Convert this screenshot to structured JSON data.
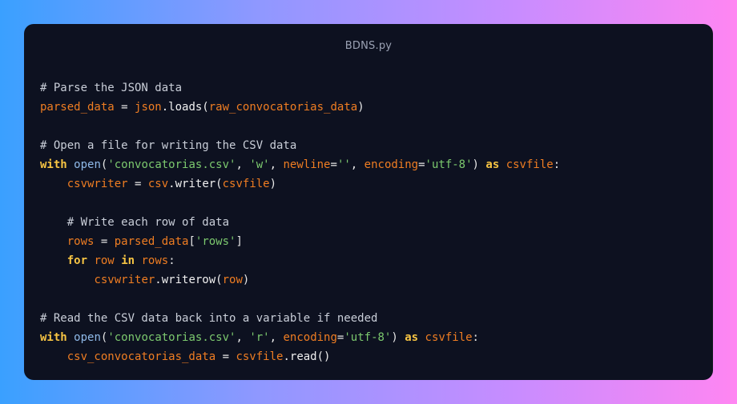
{
  "window": {
    "title": "BDNS.py"
  },
  "code_lines": [
    [
      {
        "t": "# Parse the JSON data",
        "k": "comment"
      }
    ],
    [
      {
        "t": "parsed_data",
        "k": "var"
      },
      {
        "t": " = ",
        "k": "plain"
      },
      {
        "t": "json",
        "k": "var"
      },
      {
        "t": ".loads(",
        "k": "fn"
      },
      {
        "t": "raw_convocatorias_data",
        "k": "var"
      },
      {
        "t": ")",
        "k": "plain"
      }
    ],
    [],
    [
      {
        "t": "# Open a file for writing the CSV data",
        "k": "comment"
      }
    ],
    [
      {
        "t": "with",
        "k": "kw"
      },
      {
        "t": " ",
        "k": "plain"
      },
      {
        "t": "open",
        "k": "builtin"
      },
      {
        "t": "(",
        "k": "plain"
      },
      {
        "t": "'convocatorias.csv'",
        "k": "str"
      },
      {
        "t": ", ",
        "k": "plain"
      },
      {
        "t": "'w'",
        "k": "str"
      },
      {
        "t": ", ",
        "k": "plain"
      },
      {
        "t": "newline",
        "k": "var"
      },
      {
        "t": "=",
        "k": "plain"
      },
      {
        "t": "''",
        "k": "str"
      },
      {
        "t": ", ",
        "k": "plain"
      },
      {
        "t": "encoding",
        "k": "var"
      },
      {
        "t": "=",
        "k": "plain"
      },
      {
        "t": "'utf-8'",
        "k": "str"
      },
      {
        "t": ") ",
        "k": "plain"
      },
      {
        "t": "as",
        "k": "kw"
      },
      {
        "t": " ",
        "k": "plain"
      },
      {
        "t": "csvfile",
        "k": "var"
      },
      {
        "t": ":",
        "k": "plain"
      }
    ],
    [
      {
        "t": "    ",
        "k": "plain"
      },
      {
        "t": "csvwriter",
        "k": "var"
      },
      {
        "t": " = ",
        "k": "plain"
      },
      {
        "t": "csv",
        "k": "var"
      },
      {
        "t": ".writer(",
        "k": "fn"
      },
      {
        "t": "csvfile",
        "k": "var"
      },
      {
        "t": ")",
        "k": "plain"
      }
    ],
    [],
    [
      {
        "t": "    # Write each row of data",
        "k": "comment"
      }
    ],
    [
      {
        "t": "    ",
        "k": "plain"
      },
      {
        "t": "rows",
        "k": "var"
      },
      {
        "t": " = ",
        "k": "plain"
      },
      {
        "t": "parsed_data",
        "k": "var"
      },
      {
        "t": "[",
        "k": "plain"
      },
      {
        "t": "'rows'",
        "k": "str"
      },
      {
        "t": "]",
        "k": "plain"
      }
    ],
    [
      {
        "t": "    ",
        "k": "plain"
      },
      {
        "t": "for",
        "k": "kw"
      },
      {
        "t": " ",
        "k": "plain"
      },
      {
        "t": "row",
        "k": "var"
      },
      {
        "t": " ",
        "k": "plain"
      },
      {
        "t": "in",
        "k": "kw"
      },
      {
        "t": " ",
        "k": "plain"
      },
      {
        "t": "rows",
        "k": "var"
      },
      {
        "t": ":",
        "k": "plain"
      }
    ],
    [
      {
        "t": "        ",
        "k": "plain"
      },
      {
        "t": "csvwriter",
        "k": "var"
      },
      {
        "t": ".writerow(",
        "k": "fn"
      },
      {
        "t": "row",
        "k": "var"
      },
      {
        "t": ")",
        "k": "plain"
      }
    ],
    [],
    [
      {
        "t": "# Read the CSV data back into a variable if needed",
        "k": "comment"
      }
    ],
    [
      {
        "t": "with",
        "k": "kw"
      },
      {
        "t": " ",
        "k": "plain"
      },
      {
        "t": "open",
        "k": "builtin"
      },
      {
        "t": "(",
        "k": "plain"
      },
      {
        "t": "'convocatorias.csv'",
        "k": "str"
      },
      {
        "t": ", ",
        "k": "plain"
      },
      {
        "t": "'r'",
        "k": "str"
      },
      {
        "t": ", ",
        "k": "plain"
      },
      {
        "t": "encoding",
        "k": "var"
      },
      {
        "t": "=",
        "k": "plain"
      },
      {
        "t": "'utf-8'",
        "k": "str"
      },
      {
        "t": ") ",
        "k": "plain"
      },
      {
        "t": "as",
        "k": "kw"
      },
      {
        "t": " ",
        "k": "plain"
      },
      {
        "t": "csvfile",
        "k": "var"
      },
      {
        "t": ":",
        "k": "plain"
      }
    ],
    [
      {
        "t": "    ",
        "k": "plain"
      },
      {
        "t": "csv_convocatorias_data",
        "k": "var"
      },
      {
        "t": " = ",
        "k": "plain"
      },
      {
        "t": "csvfile",
        "k": "var"
      },
      {
        "t": ".read()",
        "k": "fn"
      }
    ]
  ],
  "colors": {
    "background_gradient": [
      "#3aa0ff",
      "#8f98ff",
      "#c88cff",
      "#ff86f2"
    ],
    "window_bg": "#0d1120",
    "comment": "#c9ced8",
    "variable": "#ef7d22",
    "keyword": "#f6c443",
    "builtin": "#8fb9e8",
    "string": "#7cc96e"
  }
}
